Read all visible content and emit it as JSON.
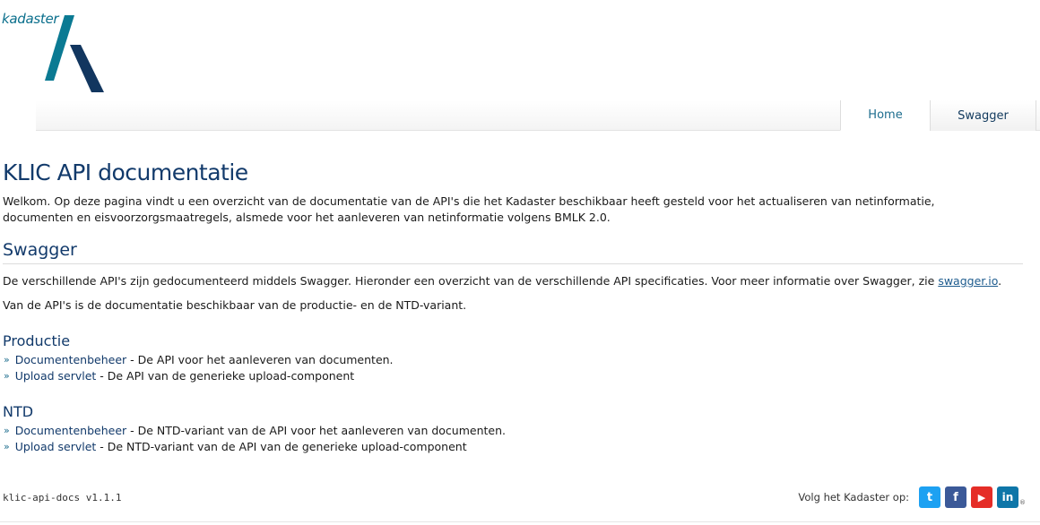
{
  "header": {
    "logo_text": "kadaster",
    "nav_tabs": [
      {
        "label": "Home",
        "active": true
      },
      {
        "label": "Swagger",
        "active": false
      }
    ]
  },
  "main": {
    "title": "KLIC API documentatie",
    "intro": "Welkom. Op deze pagina vindt u een overzicht van de documentatie van de API's die het Kadaster beschikbaar heeft gesteld voor het actualiseren van netinformatie, documenten en eisvoorzorgsmaatregels, alsmede voor het aanleveren van netinformatie volgens BMLK 2.0.",
    "swagger_section": {
      "heading": "Swagger",
      "paragraph1_prefix": "De verschillende API's zijn gedocumenteerd middels Swagger. Hieronder een overzicht van de verschillende API specificaties. Voor meer informatie over Swagger, zie ",
      "paragraph1_link": "swagger.io",
      "paragraph1_suffix": ".",
      "paragraph2": "Van de API's is de documentatie beschikbaar van de productie- en de NTD-variant."
    },
    "productie": {
      "heading": "Productie",
      "items": [
        {
          "link": "Documentenbeheer",
          "desc": " - De API voor het aanleveren van documenten."
        },
        {
          "link": "Upload servlet",
          "desc": " - De API van de generieke upload-component"
        }
      ]
    },
    "ntd": {
      "heading": "NTD",
      "items": [
        {
          "link": "Documentenbeheer",
          "desc": " - De NTD-variant van de API voor het aanleveren van documenten."
        },
        {
          "link": "Upload servlet",
          "desc": " - De NTD-variant van de API van de generieke upload-component"
        }
      ]
    }
  },
  "footer": {
    "version": "klic-api-docs v1.1.1",
    "social_label": "Volg het Kadaster op:",
    "social_icons": [
      {
        "name": "twitter-icon",
        "glyph": "t",
        "color": "#1da1f2"
      },
      {
        "name": "facebook-icon",
        "glyph": "f",
        "color": "#3b5998"
      },
      {
        "name": "youtube-icon",
        "glyph": "▶",
        "color": "#e52d27"
      },
      {
        "name": "linkedin-icon",
        "glyph": "in",
        "color": "#0e76a8"
      }
    ],
    "registered_mark": "®"
  },
  "colors": {
    "brand_teal": "#0b6f8c",
    "brand_navy": "#123a6b",
    "link": "#1d5b8e"
  }
}
